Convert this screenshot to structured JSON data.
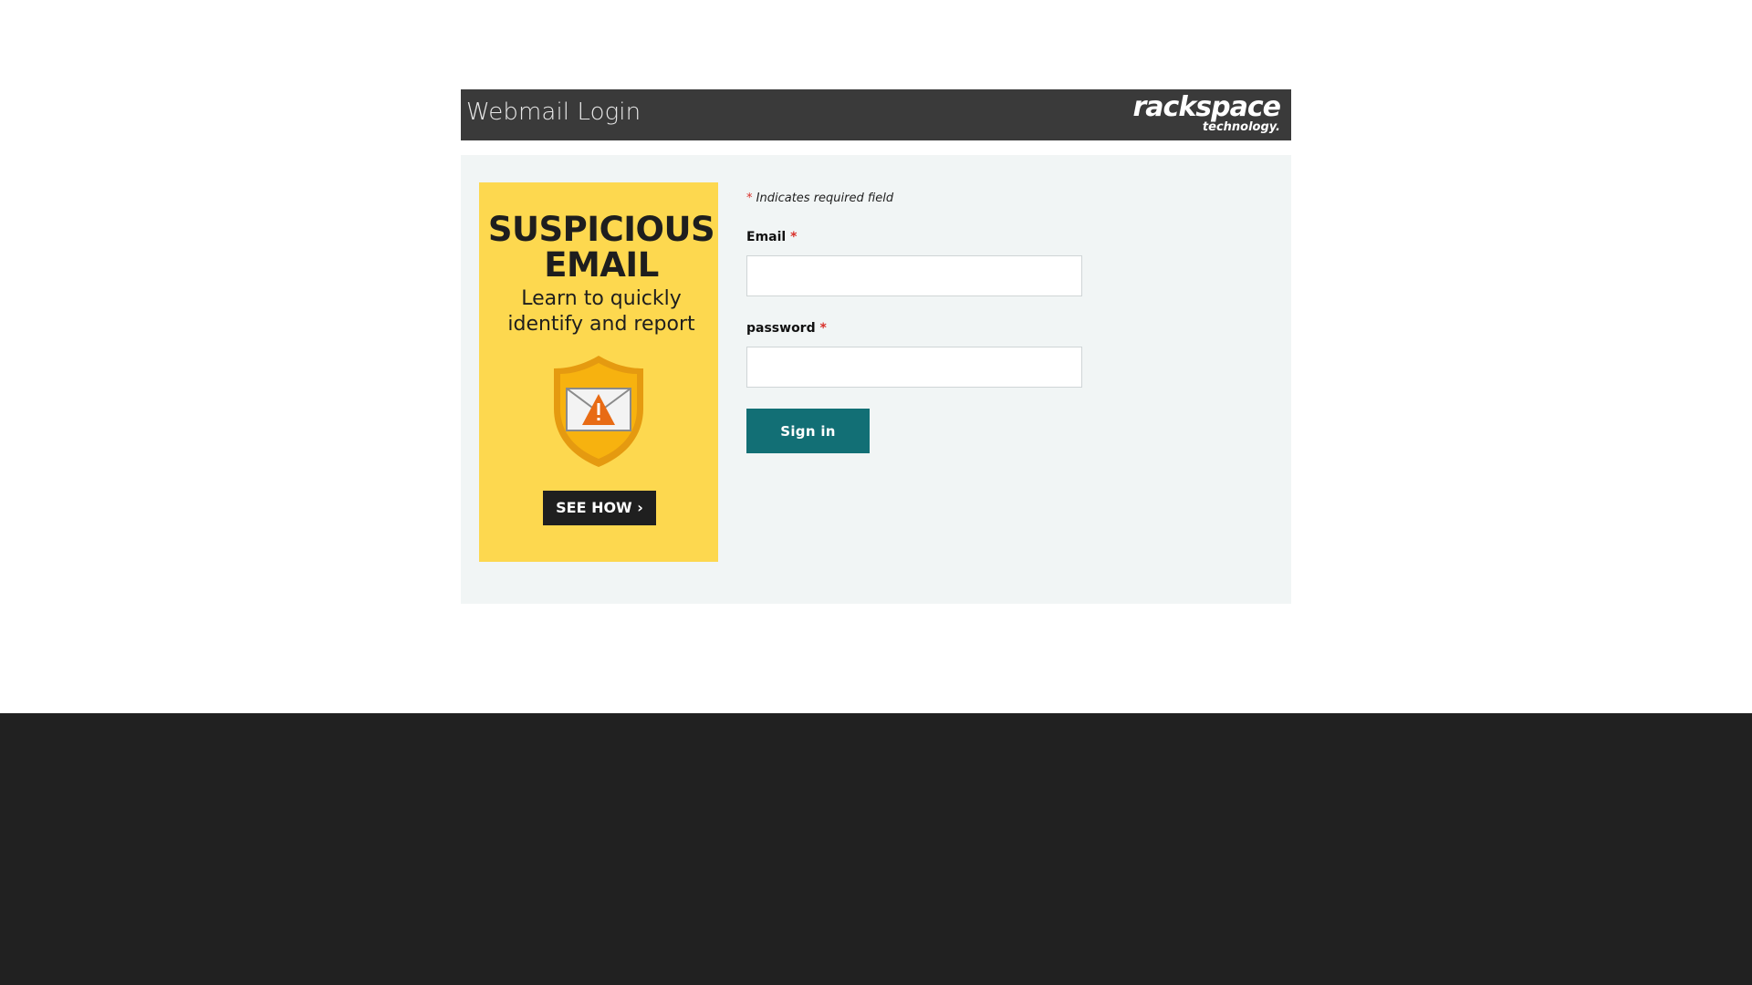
{
  "header": {
    "title": "Webmail Login",
    "brand_name": "rackspace",
    "brand_sub": "technology."
  },
  "promo": {
    "title_line1": "SUSPICIOUS",
    "title_line2": "EMAIL",
    "subtitle_line1": "Learn to quickly",
    "subtitle_line2": "identify and report",
    "cta_label": "SEE HOW ›",
    "icon": "shield-envelope-warning-icon",
    "background_color": "#fdd84f"
  },
  "form": {
    "required_marker": "*",
    "required_note": "Indicates required field",
    "email_label": "Email",
    "email_value": "",
    "password_label": "password",
    "password_value": "",
    "signin_label": "Sign in"
  },
  "colors": {
    "header_bg": "#3a3a3a",
    "panel_bg": "#f1f5f5",
    "button_bg": "#126f75",
    "asterisk": "#d9302a",
    "footer_bg": "#212121"
  }
}
